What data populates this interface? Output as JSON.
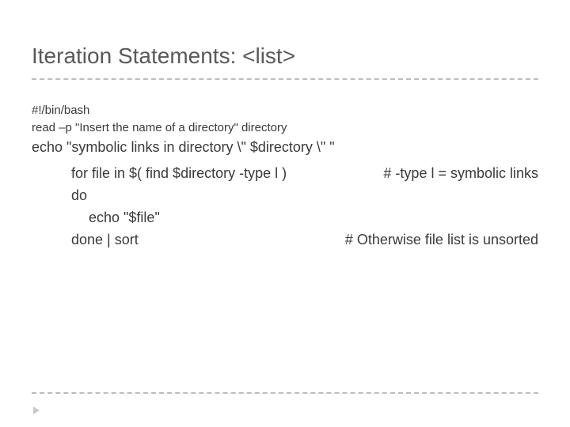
{
  "title": "Iteration Statements: <list>",
  "body": {
    "lines_small": [
      "#!/bin/bash",
      "read –p \"Insert the name of a directory\" directory"
    ],
    "line_echo": "echo \"symbolic links in directory  \\\" $directory \\\" \"",
    "code": {
      "for_line": "for file in  $( find $directory -type l )",
      "for_comment": "# -type l = symbolic links",
      "do_line": "do",
      "echo_inner": "echo \"$file\"",
      "done_line": "done | sort",
      "done_comment": "# Otherwise file list is unsorted"
    }
  }
}
